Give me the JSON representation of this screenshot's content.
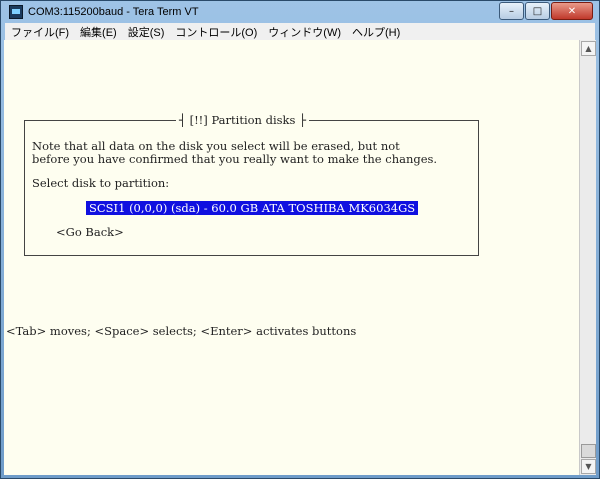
{
  "window": {
    "title": "COM3:115200baud - Tera Term VT",
    "controls": {
      "minimize": "–",
      "maximize": "□",
      "close": "✕"
    }
  },
  "menu": [
    "ファイル(F)",
    "編集(E)",
    "設定(S)",
    "コントロール(O)",
    "ウィンドウ(W)",
    "ヘルプ(H)"
  ],
  "terminal": {
    "dialog_title": "┤ [!!] Partition disks ├",
    "note_line1": "Note that all data on the disk you select will be erased, but not",
    "note_line2": "before you have confirmed that you really want to make the changes.",
    "prompt": "Select disk to partition:",
    "disk_option": "SCSI1 (0,0,0) (sda) - 60.0 GB ATA TOSHIBA MK6034GS",
    "go_back": "<Go Back>",
    "help_line": "<Tab> moves; <Space> selects; <Enter> activates buttons"
  },
  "colors": {
    "terminal_bg": "#fefef0",
    "selection_bg": "#1010e0",
    "selection_fg": "#ffffff"
  },
  "icons": {
    "app": "tera-term-icon",
    "scroll_up": "arrow-up-icon",
    "scroll_down": "arrow-down-icon"
  }
}
